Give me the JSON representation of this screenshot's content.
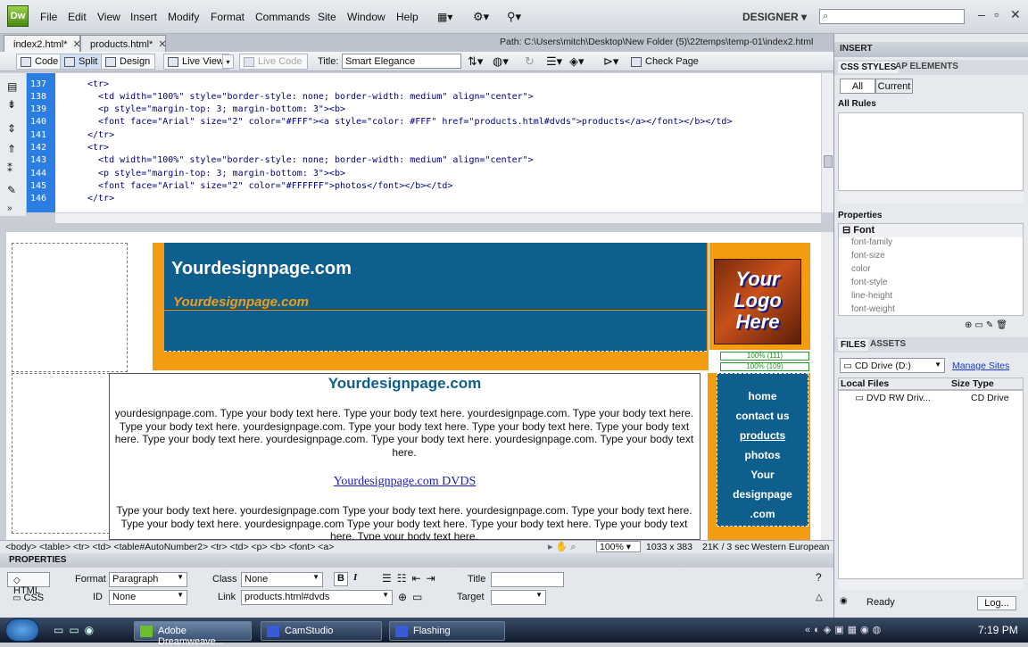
{
  "app": {
    "logo": "Dw",
    "menus": [
      "File",
      "Edit",
      "View",
      "Insert",
      "Modify",
      "Format",
      "Commands",
      "Site",
      "Window",
      "Help"
    ],
    "workspace": "DESIGNER"
  },
  "tabs": [
    {
      "label": "index2.html*"
    },
    {
      "label": "products.html*"
    }
  ],
  "path": "Path:  C:\\Users\\mitch\\Desktop\\New Folder (5)\\22temps\\temp-01\\index2.html",
  "toolbar": {
    "code": "Code",
    "split": "Split",
    "design": "Design",
    "live_view": "Live View",
    "live_code": "Live Code",
    "title_label": "Title:",
    "title_value": "Smart Elegance",
    "check_page": "Check Page"
  },
  "code": {
    "line_numbers": [
      "137",
      "138",
      "139",
      "140",
      "141",
      "142",
      "143",
      "144",
      "145",
      "146"
    ],
    "lines": [
      "<tr>",
      "  <td width=\"100%\" style=\"border-style: none; border-width: medium\" align=\"center\">",
      "  <p style=\"margin-top: 3; margin-bottom: 3\"><b>",
      "  <font face=\"Arial\" size=\"2\" color=\"#FFF\"><a style=\"color: #FFF\" href=\"products.html#dvds\">products</a></font></b></td>",
      "</tr>",
      "<tr>",
      "  <td width=\"100%\" style=\"border-style: none; border-width: medium\" align=\"center\">",
      "  <p style=\"margin-top: 3; margin-bottom: 3\"><b>",
      "  <font face=\"Arial\" size=\"2\" color=\"#FFFFFF\">photos</font></b></td>",
      "</tr>"
    ]
  },
  "page": {
    "header_title": "Yourdesignpage.com",
    "header_subtitle": "Yourdesignpage.com",
    "logo_text": "Your Logo Here",
    "width_labels": [
      "100% (111)",
      "100% (109)"
    ],
    "content_title": "Yourdesignpage.com",
    "para1": "yourdesignpage.com. Type your body text here. Type your body text here. yourdesignpage.com. Type your body text here. Type your body text here. yourdesignpage.com. Type your body text here. Type your body text here. Type your body text here. Type your body text here. yourdesignpage.com. Type your body text here. yourdesignpage.com. Type your body text here.",
    "link": "Yourdesignpage.com DVDS",
    "para2": "Type your body text here. yourdesignpage.com Type your body text here. yourdesignpage.com. Type your body text here. Type your body text here. yourdesignpage.com Type your body text here. Type your body text here. Type your body text here. Type your body text here.",
    "nav": [
      "home",
      "contact us",
      "products",
      "photos",
      "Your",
      "designpage",
      ".com"
    ]
  },
  "status": {
    "tags": "<body> <table> <tr> <td> <table#AutoNumber2> <tr> <td> <p> <b> <font> <a>",
    "zoom": "100%",
    "size": "1033 x 383",
    "weight": "21K / 3 sec",
    "encoding": "Western European"
  },
  "properties": {
    "header": "PROPERTIES",
    "html": "HTML",
    "css": "CSS",
    "format_label": "Format",
    "format": "Paragraph",
    "class_label": "Class",
    "class": "None",
    "id_label": "ID",
    "id": "None",
    "link_label": "Link",
    "link": "products.html#dvds",
    "title_label": "Title",
    "target_label": "Target",
    "bold": "B",
    "italic": "I"
  },
  "panels": {
    "insert": "INSERT",
    "css_styles": "CSS STYLES",
    "ap_elements": "AP ELEMENTS",
    "all": "All",
    "current": "Current",
    "all_rules": "All Rules",
    "properties": "Properties",
    "font_group": "Font",
    "font_props": [
      "font-family",
      "font-size",
      "color",
      "font-style",
      "line-height",
      "font-weight"
    ],
    "files": "FILES",
    "assets": "ASSETS",
    "drive": "CD Drive (D:)",
    "manage_sites": "Manage Sites",
    "local_files": "Local Files",
    "size_col": "Size",
    "type_col": "Type",
    "file_name": "DVD RW Driv...",
    "file_type": "CD Drive",
    "ready": "Ready",
    "log": "Log..."
  },
  "taskbar": {
    "items": [
      "Adobe Dreamweave...",
      "CamStudio",
      "Flashing"
    ],
    "clock": "7:19 PM"
  }
}
